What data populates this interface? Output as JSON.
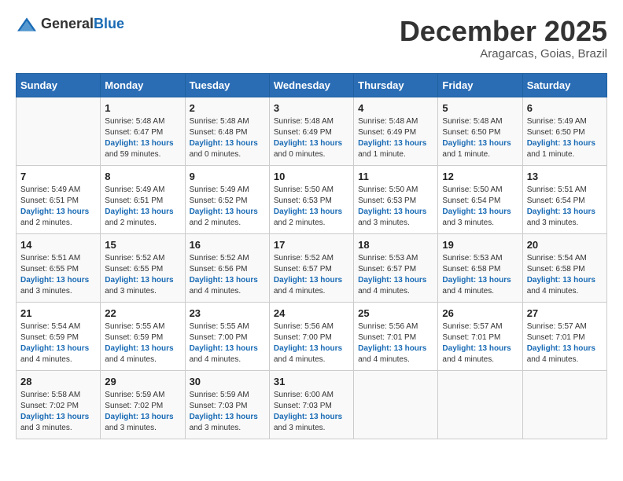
{
  "header": {
    "logo_general": "General",
    "logo_blue": "Blue",
    "month": "December 2025",
    "location": "Aragarcas, Goias, Brazil"
  },
  "weekdays": [
    "Sunday",
    "Monday",
    "Tuesday",
    "Wednesday",
    "Thursday",
    "Friday",
    "Saturday"
  ],
  "weeks": [
    [
      {
        "day": "",
        "sunrise": "",
        "sunset": "",
        "daylight_label": "",
        "daylight": ""
      },
      {
        "day": "1",
        "sunrise": "Sunrise: 5:48 AM",
        "sunset": "Sunset: 6:47 PM",
        "daylight_label": "Daylight: 13 hours",
        "daylight": "and 59 minutes."
      },
      {
        "day": "2",
        "sunrise": "Sunrise: 5:48 AM",
        "sunset": "Sunset: 6:48 PM",
        "daylight_label": "Daylight: 13 hours",
        "daylight": "and 0 minutes."
      },
      {
        "day": "3",
        "sunrise": "Sunrise: 5:48 AM",
        "sunset": "Sunset: 6:49 PM",
        "daylight_label": "Daylight: 13 hours",
        "daylight": "and 0 minutes."
      },
      {
        "day": "4",
        "sunrise": "Sunrise: 5:48 AM",
        "sunset": "Sunset: 6:49 PM",
        "daylight_label": "Daylight: 13 hours",
        "daylight": "and 1 minute."
      },
      {
        "day": "5",
        "sunrise": "Sunrise: 5:48 AM",
        "sunset": "Sunset: 6:50 PM",
        "daylight_label": "Daylight: 13 hours",
        "daylight": "and 1 minute."
      },
      {
        "day": "6",
        "sunrise": "Sunrise: 5:49 AM",
        "sunset": "Sunset: 6:50 PM",
        "daylight_label": "Daylight: 13 hours",
        "daylight": "and 1 minute."
      }
    ],
    [
      {
        "day": "7",
        "sunrise": "Sunrise: 5:49 AM",
        "sunset": "Sunset: 6:51 PM",
        "daylight_label": "Daylight: 13 hours",
        "daylight": "and 2 minutes."
      },
      {
        "day": "8",
        "sunrise": "Sunrise: 5:49 AM",
        "sunset": "Sunset: 6:51 PM",
        "daylight_label": "Daylight: 13 hours",
        "daylight": "and 2 minutes."
      },
      {
        "day": "9",
        "sunrise": "Sunrise: 5:49 AM",
        "sunset": "Sunset: 6:52 PM",
        "daylight_label": "Daylight: 13 hours",
        "daylight": "and 2 minutes."
      },
      {
        "day": "10",
        "sunrise": "Sunrise: 5:50 AM",
        "sunset": "Sunset: 6:53 PM",
        "daylight_label": "Daylight: 13 hours",
        "daylight": "and 2 minutes."
      },
      {
        "day": "11",
        "sunrise": "Sunrise: 5:50 AM",
        "sunset": "Sunset: 6:53 PM",
        "daylight_label": "Daylight: 13 hours",
        "daylight": "and 3 minutes."
      },
      {
        "day": "12",
        "sunrise": "Sunrise: 5:50 AM",
        "sunset": "Sunset: 6:54 PM",
        "daylight_label": "Daylight: 13 hours",
        "daylight": "and 3 minutes."
      },
      {
        "day": "13",
        "sunrise": "Sunrise: 5:51 AM",
        "sunset": "Sunset: 6:54 PM",
        "daylight_label": "Daylight: 13 hours",
        "daylight": "and 3 minutes."
      }
    ],
    [
      {
        "day": "14",
        "sunrise": "Sunrise: 5:51 AM",
        "sunset": "Sunset: 6:55 PM",
        "daylight_label": "Daylight: 13 hours",
        "daylight": "and 3 minutes."
      },
      {
        "day": "15",
        "sunrise": "Sunrise: 5:52 AM",
        "sunset": "Sunset: 6:55 PM",
        "daylight_label": "Daylight: 13 hours",
        "daylight": "and 3 minutes."
      },
      {
        "day": "16",
        "sunrise": "Sunrise: 5:52 AM",
        "sunset": "Sunset: 6:56 PM",
        "daylight_label": "Daylight: 13 hours",
        "daylight": "and 4 minutes."
      },
      {
        "day": "17",
        "sunrise": "Sunrise: 5:52 AM",
        "sunset": "Sunset: 6:57 PM",
        "daylight_label": "Daylight: 13 hours",
        "daylight": "and 4 minutes."
      },
      {
        "day": "18",
        "sunrise": "Sunrise: 5:53 AM",
        "sunset": "Sunset: 6:57 PM",
        "daylight_label": "Daylight: 13 hours",
        "daylight": "and 4 minutes."
      },
      {
        "day": "19",
        "sunrise": "Sunrise: 5:53 AM",
        "sunset": "Sunset: 6:58 PM",
        "daylight_label": "Daylight: 13 hours",
        "daylight": "and 4 minutes."
      },
      {
        "day": "20",
        "sunrise": "Sunrise: 5:54 AM",
        "sunset": "Sunset: 6:58 PM",
        "daylight_label": "Daylight: 13 hours",
        "daylight": "and 4 minutes."
      }
    ],
    [
      {
        "day": "21",
        "sunrise": "Sunrise: 5:54 AM",
        "sunset": "Sunset: 6:59 PM",
        "daylight_label": "Daylight: 13 hours",
        "daylight": "and 4 minutes."
      },
      {
        "day": "22",
        "sunrise": "Sunrise: 5:55 AM",
        "sunset": "Sunset: 6:59 PM",
        "daylight_label": "Daylight: 13 hours",
        "daylight": "and 4 minutes."
      },
      {
        "day": "23",
        "sunrise": "Sunrise: 5:55 AM",
        "sunset": "Sunset: 7:00 PM",
        "daylight_label": "Daylight: 13 hours",
        "daylight": "and 4 minutes."
      },
      {
        "day": "24",
        "sunrise": "Sunrise: 5:56 AM",
        "sunset": "Sunset: 7:00 PM",
        "daylight_label": "Daylight: 13 hours",
        "daylight": "and 4 minutes."
      },
      {
        "day": "25",
        "sunrise": "Sunrise: 5:56 AM",
        "sunset": "Sunset: 7:01 PM",
        "daylight_label": "Daylight: 13 hours",
        "daylight": "and 4 minutes."
      },
      {
        "day": "26",
        "sunrise": "Sunrise: 5:57 AM",
        "sunset": "Sunset: 7:01 PM",
        "daylight_label": "Daylight: 13 hours",
        "daylight": "and 4 minutes."
      },
      {
        "day": "27",
        "sunrise": "Sunrise: 5:57 AM",
        "sunset": "Sunset: 7:01 PM",
        "daylight_label": "Daylight: 13 hours",
        "daylight": "and 4 minutes."
      }
    ],
    [
      {
        "day": "28",
        "sunrise": "Sunrise: 5:58 AM",
        "sunset": "Sunset: 7:02 PM",
        "daylight_label": "Daylight: 13 hours",
        "daylight": "and 3 minutes."
      },
      {
        "day": "29",
        "sunrise": "Sunrise: 5:59 AM",
        "sunset": "Sunset: 7:02 PM",
        "daylight_label": "Daylight: 13 hours",
        "daylight": "and 3 minutes."
      },
      {
        "day": "30",
        "sunrise": "Sunrise: 5:59 AM",
        "sunset": "Sunset: 7:03 PM",
        "daylight_label": "Daylight: 13 hours",
        "daylight": "and 3 minutes."
      },
      {
        "day": "31",
        "sunrise": "Sunrise: 6:00 AM",
        "sunset": "Sunset: 7:03 PM",
        "daylight_label": "Daylight: 13 hours",
        "daylight": "and 3 minutes."
      },
      {
        "day": "",
        "sunrise": "",
        "sunset": "",
        "daylight_label": "",
        "daylight": ""
      },
      {
        "day": "",
        "sunrise": "",
        "sunset": "",
        "daylight_label": "",
        "daylight": ""
      },
      {
        "day": "",
        "sunrise": "",
        "sunset": "",
        "daylight_label": "",
        "daylight": ""
      }
    ]
  ]
}
